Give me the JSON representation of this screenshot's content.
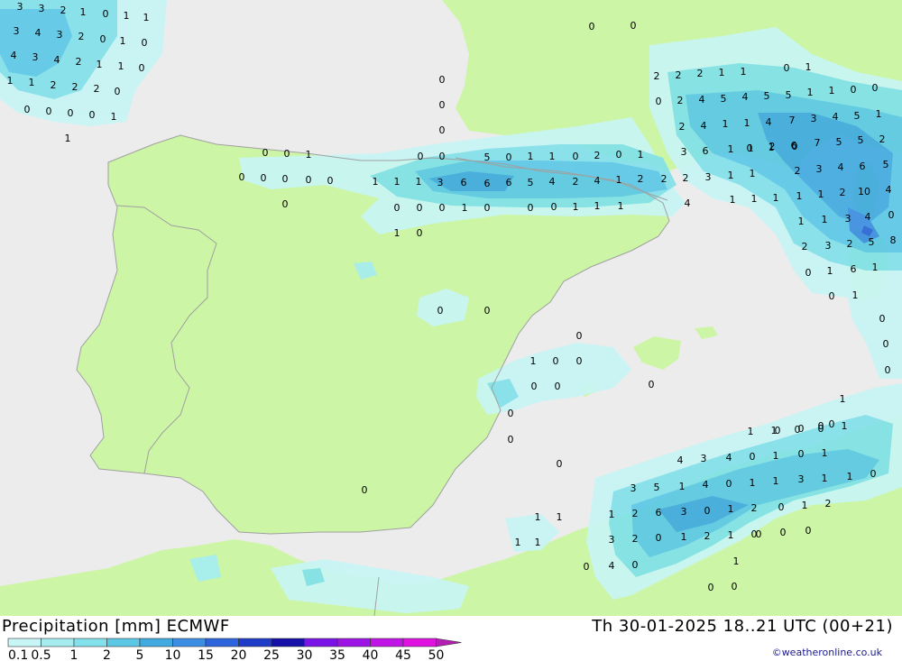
{
  "title": "Precipitation [mm] ECMWF",
  "datetime": "Th 30-01-2025 18..21 UTC (00+21)",
  "credit": "©weatheronline.co.uk",
  "colors": {
    "sea": "#ececec",
    "land": "#ccf5a5",
    "border": "#a0a0a0",
    "coast": "#8a8a8a"
  },
  "legend": {
    "labels": [
      "0.1",
      "0.5",
      "1",
      "2",
      "5",
      "10",
      "15",
      "20",
      "25",
      "30",
      "35",
      "40",
      "45",
      "50"
    ],
    "colors": [
      "#c8f5f5",
      "#a5edf0",
      "#82e1ea",
      "#5cc8e6",
      "#41aae0",
      "#3c8ee2",
      "#2c64dc",
      "#1f3cc8",
      "#1410a8",
      "#7a14e6",
      "#9c14e6",
      "#c014e6",
      "#e010e0",
      "#b41eb4"
    ]
  },
  "map_values": [
    "3",
    "3",
    "2",
    "1",
    "0",
    "1",
    "1",
    "3",
    "4",
    "3",
    "2",
    "0",
    "1",
    "0",
    "4",
    "3",
    "4",
    "2",
    "1",
    "1",
    "0",
    "1",
    "1",
    "2",
    "2",
    "2",
    "0",
    "0",
    "0",
    "0",
    "0",
    "1",
    "1",
    "0",
    "0",
    "0",
    "0",
    "0",
    "1",
    "0",
    "0",
    "0",
    "0",
    "0",
    "0",
    "0",
    "5",
    "0",
    "1",
    "1",
    "0",
    "2",
    "0",
    "1",
    "3",
    "6",
    "1",
    "0",
    "1",
    "0",
    "1",
    "1",
    "1",
    "3",
    "6",
    "6",
    "6",
    "5",
    "4",
    "2",
    "4",
    "1",
    "2",
    "2",
    "2",
    "3",
    "1",
    "0",
    "0",
    "0",
    "1",
    "0",
    "0",
    "0",
    "1",
    "1",
    "1",
    "1",
    "0",
    "0",
    "0",
    "0",
    "0",
    "1",
    "0",
    "0",
    "0",
    "0",
    "0",
    "0",
    "0",
    "0",
    "0",
    "0",
    "0",
    "2",
    "2",
    "2",
    "1",
    "1",
    "0",
    "1",
    "0",
    "2",
    "4",
    "5",
    "4",
    "5",
    "5",
    "1",
    "1",
    "0",
    "0",
    "2",
    "4",
    "1",
    "1",
    "4",
    "7",
    "3",
    "4",
    "5",
    "1",
    "1",
    "2",
    "6",
    "7",
    "5",
    "5",
    "2",
    "1",
    "2",
    "3",
    "4",
    "6",
    "5",
    "1",
    "1",
    "1",
    "1",
    "1",
    "2",
    "10",
    "4",
    "4",
    "1",
    "1",
    "3",
    "4",
    "0",
    "2",
    "3",
    "2",
    "5",
    "8",
    "0",
    "1",
    "6",
    "1",
    "0",
    "1",
    "0",
    "0",
    "0",
    "1",
    "0",
    "0",
    "0",
    "0",
    "1",
    "1",
    "0",
    "0",
    "1",
    "4",
    "3",
    "4",
    "0",
    "1",
    "0",
    "1",
    "3",
    "5",
    "1",
    "4",
    "0",
    "1",
    "1",
    "3",
    "1",
    "1",
    "0",
    "1",
    "2",
    "6",
    "3",
    "0",
    "1",
    "2",
    "3",
    "2",
    "0",
    "1",
    "2",
    "1",
    "0",
    "0",
    "1",
    "2",
    "0",
    "0",
    "0",
    "1",
    "1",
    "1",
    "1",
    "1",
    "0",
    "0",
    "0",
    "4",
    "0"
  ]
}
